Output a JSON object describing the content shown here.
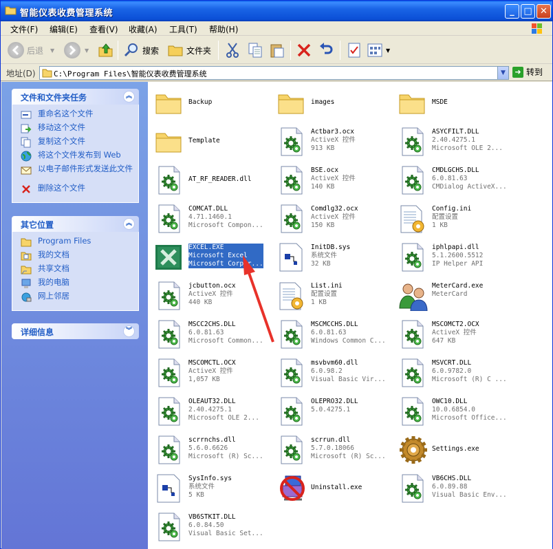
{
  "window": {
    "title": "智能仪表收费管理系统",
    "controls": {
      "minimize": "_",
      "maximize": "□",
      "close": "✕"
    }
  },
  "menu": [
    "文件(F)",
    "编辑(E)",
    "查看(V)",
    "收藏(A)",
    "工具(T)",
    "帮助(H)"
  ],
  "toolbar": {
    "back": "后退",
    "search": "搜索",
    "folders": "文件夹"
  },
  "address": {
    "label": "地址(D)",
    "path": "C:\\Program Files\\智能仪表收费管理系统",
    "go": "转到"
  },
  "sidebar": {
    "tasks": {
      "title": "文件和文件夹任务",
      "items": [
        "重命名这个文件",
        "移动这个文件",
        "复制这个文件",
        "将这个文件发布到 Web",
        "以电子邮件形式发送此文件",
        "删除这个文件"
      ]
    },
    "places": {
      "title": "其它位置",
      "items": [
        "Program Files",
        "我的文档",
        "共享文档",
        "我的电脑",
        "网上邻居"
      ]
    },
    "details": {
      "title": "详细信息"
    }
  },
  "files": [
    {
      "name": "Backup",
      "lines": [],
      "icon": "folder"
    },
    {
      "name": "images",
      "lines": [],
      "icon": "folder"
    },
    {
      "name": "MSDE",
      "lines": [],
      "icon": "folder"
    },
    {
      "name": "Template",
      "lines": [],
      "icon": "folder"
    },
    {
      "name": "Actbar3.ocx",
      "lines": [
        "ActiveX 控件",
        "913 KB"
      ],
      "icon": "dll"
    },
    {
      "name": "ASYCFILT.DLL",
      "lines": [
        "2.40.4275.1",
        "Microsoft OLE 2..."
      ],
      "icon": "dll"
    },
    {
      "name": "AT_RF_READER.dll",
      "lines": [],
      "icon": "dll"
    },
    {
      "name": "BSE.ocx",
      "lines": [
        "ActiveX 控件",
        "140 KB"
      ],
      "icon": "dll"
    },
    {
      "name": "CMDLGCHS.DLL",
      "lines": [
        "6.0.81.63",
        "CMDialog ActiveX..."
      ],
      "icon": "dll"
    },
    {
      "name": "COMCAT.DLL",
      "lines": [
        "4.71.1460.1",
        "Microsoft Compon..."
      ],
      "icon": "dll"
    },
    {
      "name": "Comdlg32.ocx",
      "lines": [
        "ActiveX 控件",
        "150 KB"
      ],
      "icon": "dll"
    },
    {
      "name": "Config.ini",
      "lines": [
        "配置设置",
        "1 KB"
      ],
      "icon": "ini"
    },
    {
      "name": "EXCEL.EXE",
      "lines": [
        "Microsoft Excel",
        "Microsoft Corpor..."
      ],
      "icon": "excel"
    },
    {
      "name": "InitDB.sys",
      "lines": [
        "系统文件",
        "32 KB"
      ],
      "icon": "sys"
    },
    {
      "name": "iphlpapi.dll",
      "lines": [
        "5.1.2600.5512",
        "IP Helper API"
      ],
      "icon": "dll"
    },
    {
      "name": "jcbutton.ocx",
      "lines": [
        "ActiveX 控件",
        "440 KB"
      ],
      "icon": "dll"
    },
    {
      "name": "List.ini",
      "lines": [
        "配置设置",
        "1 KB"
      ],
      "icon": "ini"
    },
    {
      "name": "MeterCard.exe",
      "lines": [
        "MeterCard"
      ],
      "icon": "people"
    },
    {
      "name": "MSCC2CHS.DLL",
      "lines": [
        "6.0.81.63",
        "Microsoft Common..."
      ],
      "icon": "dll"
    },
    {
      "name": "MSCMCCHS.DLL",
      "lines": [
        "6.0.81.63",
        "Windows Common C..."
      ],
      "icon": "dll"
    },
    {
      "name": "MSCOMCT2.OCX",
      "lines": [
        "ActiveX 控件",
        "647 KB"
      ],
      "icon": "dll"
    },
    {
      "name": "MSCOMCTL.OCX",
      "lines": [
        "ActiveX 控件",
        "1,057 KB"
      ],
      "icon": "dll"
    },
    {
      "name": "msvbvm60.dll",
      "lines": [
        "6.0.98.2",
        "Visual Basic Vir..."
      ],
      "icon": "dll"
    },
    {
      "name": "MSVCRT.DLL",
      "lines": [
        "6.0.9782.0",
        "Microsoft (R) C ..."
      ],
      "icon": "dll"
    },
    {
      "name": "OLEAUT32.DLL",
      "lines": [
        "2.40.4275.1",
        "Microsoft OLE 2..."
      ],
      "icon": "dll"
    },
    {
      "name": "OLEPRO32.DLL",
      "lines": [
        "5.0.4275.1"
      ],
      "icon": "dll"
    },
    {
      "name": "OWC10.DLL",
      "lines": [
        "10.0.6854.0",
        "Microsoft Office..."
      ],
      "icon": "dll"
    },
    {
      "name": "scrrnchs.dll",
      "lines": [
        "5.6.0.6626",
        "Microsoft (R) Sc..."
      ],
      "icon": "dll"
    },
    {
      "name": "scrrun.dll",
      "lines": [
        "5.7.0.18066",
        "Microsoft (R) Sc..."
      ],
      "icon": "dll"
    },
    {
      "name": "Settings.exe",
      "lines": [],
      "icon": "gear"
    },
    {
      "name": "SysInfo.sys",
      "lines": [
        "系统文件",
        "5 KB"
      ],
      "icon": "sys"
    },
    {
      "name": "Uninstall.exe",
      "lines": [],
      "icon": "uninstall"
    },
    {
      "name": "VB6CHS.DLL",
      "lines": [
        "6.0.89.88",
        "Visual Basic Env..."
      ],
      "icon": "dll"
    },
    {
      "name": "VB6STKIT.DLL",
      "lines": [
        "6.0.84.50",
        "Visual Basic Set..."
      ],
      "icon": "dll"
    }
  ],
  "selected_file": "EXCEL.EXE",
  "colors": {
    "accent": "#316ac5",
    "titlebar": "#0a5fe8",
    "annotation_arrow": "#e8322a"
  }
}
